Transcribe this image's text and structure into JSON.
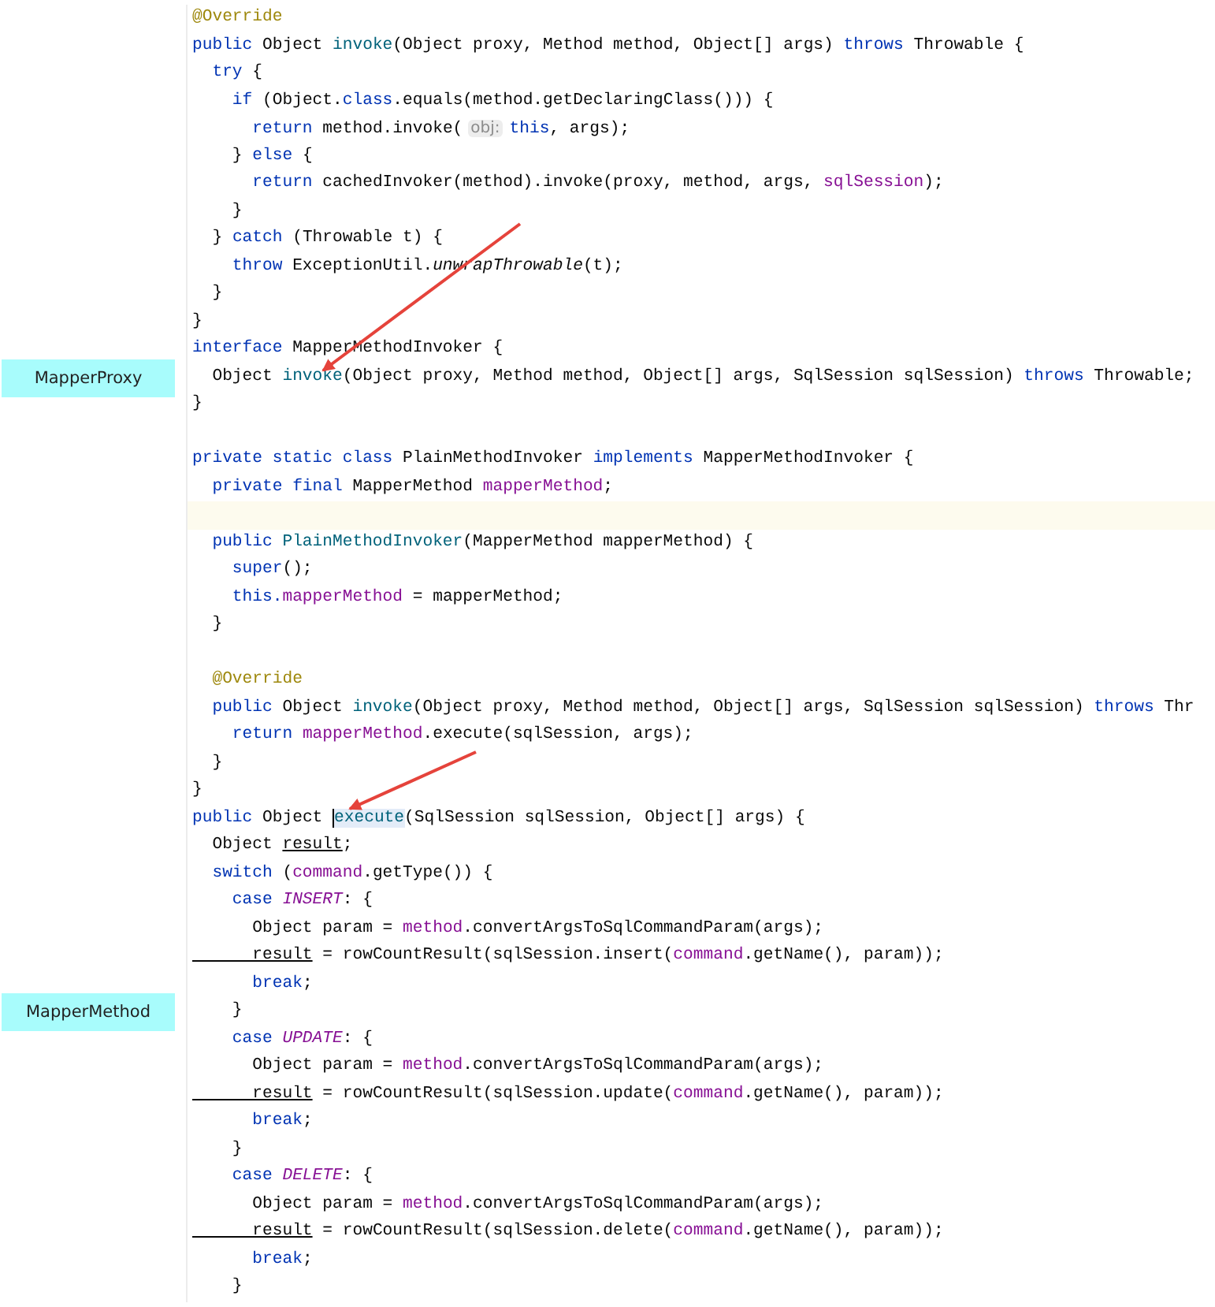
{
  "code_lines": [
    {
      "kind": "code",
      "tokens": [
        {
          "text": "@Override",
          "kind": "annotation"
        }
      ]
    },
    {
      "kind": "code",
      "tokens": [
        {
          "text": "public",
          "kind": "keyword"
        },
        {
          "text": " Object ",
          "kind": "plain"
        },
        {
          "text": "invoke",
          "kind": "declaration"
        },
        {
          "text": "(Object proxy, Method method, Object[] args) ",
          "kind": "plain"
        },
        {
          "text": "throws",
          "kind": "keyword"
        },
        {
          "text": " Throwable {",
          "kind": "plain"
        }
      ]
    },
    {
      "kind": "code",
      "tokens": [
        {
          "text": "  try",
          "kind": "keyword"
        },
        {
          "text": " {",
          "kind": "plain"
        }
      ]
    },
    {
      "kind": "code",
      "tokens": [
        {
          "text": "    if",
          "kind": "keyword"
        },
        {
          "text": " (Object.",
          "kind": "plain"
        },
        {
          "text": "class",
          "kind": "keyword"
        },
        {
          "text": ".equals(method.getDeclaringClass())) {",
          "kind": "plain"
        }
      ]
    },
    {
      "kind": "code",
      "tokens": [
        {
          "text": "      return",
          "kind": "keyword"
        },
        {
          "text": " method.invoke(",
          "kind": "plain"
        },
        {
          "text": "obj:",
          "kind": "hint"
        },
        {
          "text": "this",
          "kind": "keyword"
        },
        {
          "text": ", args);",
          "kind": "plain"
        }
      ]
    },
    {
      "kind": "code",
      "tokens": [
        {
          "text": "    } ",
          "kind": "plain"
        },
        {
          "text": "else",
          "kind": "keyword"
        },
        {
          "text": " {",
          "kind": "plain"
        }
      ]
    },
    {
      "kind": "code",
      "tokens": [
        {
          "text": "      return",
          "kind": "keyword"
        },
        {
          "text": " cachedInvoker(method).invoke(proxy, method, args, ",
          "kind": "plain"
        },
        {
          "text": "sqlSession",
          "kind": "field"
        },
        {
          "text": ");",
          "kind": "plain"
        }
      ]
    },
    {
      "kind": "code",
      "tokens": [
        {
          "text": "    }",
          "kind": "plain"
        }
      ]
    },
    {
      "kind": "code",
      "tokens": [
        {
          "text": "  } ",
          "kind": "plain"
        },
        {
          "text": "catch",
          "kind": "keyword"
        },
        {
          "text": " (Throwable t) {",
          "kind": "plain"
        }
      ]
    },
    {
      "kind": "code",
      "tokens": [
        {
          "text": "    throw",
          "kind": "keyword"
        },
        {
          "text": " ExceptionUtil.",
          "kind": "plain"
        },
        {
          "text": "unwrapThrowable",
          "kind": "static"
        },
        {
          "text": "(t);",
          "kind": "plain"
        }
      ]
    },
    {
      "kind": "code",
      "tokens": [
        {
          "text": "  }",
          "kind": "plain"
        }
      ]
    },
    {
      "kind": "code",
      "tokens": [
        {
          "text": "}",
          "kind": "plain"
        }
      ]
    },
    {
      "kind": "code",
      "tokens": [
        {
          "text": "interface",
          "kind": "keyword"
        },
        {
          "text": " MapperMethodInvoker {",
          "kind": "plain"
        }
      ]
    },
    {
      "kind": "code",
      "side_label": "MapperProxy",
      "tokens": [
        {
          "text": "  Object ",
          "kind": "plain"
        },
        {
          "text": "invoke",
          "kind": "declaration"
        },
        {
          "text": "(Object proxy, Method method, Object[] args, SqlSession sqlSession) ",
          "kind": "plain"
        },
        {
          "text": "throws",
          "kind": "keyword"
        },
        {
          "text": " Throwable;",
          "kind": "plain"
        }
      ]
    },
    {
      "kind": "code",
      "tokens": [
        {
          "text": "}",
          "kind": "plain"
        }
      ]
    },
    {
      "kind": "blank"
    },
    {
      "kind": "code",
      "tokens": [
        {
          "text": "private static class",
          "kind": "keyword"
        },
        {
          "text": " PlainMethodInvoker ",
          "kind": "plain"
        },
        {
          "text": "implements",
          "kind": "keyword"
        },
        {
          "text": " MapperMethodInvoker {",
          "kind": "plain"
        }
      ]
    },
    {
      "kind": "code",
      "tokens": [
        {
          "text": "  private final",
          "kind": "keyword"
        },
        {
          "text": " MapperMethod ",
          "kind": "plain"
        },
        {
          "text": "mapperMethod",
          "kind": "field"
        },
        {
          "text": ";",
          "kind": "plain"
        }
      ]
    },
    {
      "kind": "current"
    },
    {
      "kind": "code",
      "tokens": [
        {
          "text": "  public ",
          "kind": "keyword"
        },
        {
          "text": "PlainMethodInvoker",
          "kind": "declaration"
        },
        {
          "text": "(MapperMethod mapperMethod) {",
          "kind": "plain"
        }
      ]
    },
    {
      "kind": "code",
      "tokens": [
        {
          "text": "    super",
          "kind": "keyword"
        },
        {
          "text": "();",
          "kind": "plain"
        }
      ]
    },
    {
      "kind": "code",
      "tokens": [
        {
          "text": "    this.",
          "kind": "keyword"
        },
        {
          "text": "mapperMethod",
          "kind": "field"
        },
        {
          "text": " = mapperMethod;",
          "kind": "plain"
        }
      ]
    },
    {
      "kind": "code",
      "tokens": [
        {
          "text": "  }",
          "kind": "plain"
        }
      ]
    },
    {
      "kind": "blank"
    },
    {
      "kind": "code",
      "tokens": [
        {
          "text": "  @Override",
          "kind": "annotation"
        }
      ]
    },
    {
      "kind": "code",
      "tokens": [
        {
          "text": "  public",
          "kind": "keyword"
        },
        {
          "text": " Object ",
          "kind": "plain"
        },
        {
          "text": "invoke",
          "kind": "declaration"
        },
        {
          "text": "(Object proxy, Method method, Object[] args, SqlSession sqlSession) ",
          "kind": "plain"
        },
        {
          "text": "throws",
          "kind": "keyword"
        },
        {
          "text": " Thr",
          "kind": "plain"
        }
      ]
    },
    {
      "kind": "code",
      "tokens": [
        {
          "text": "    return ",
          "kind": "keyword"
        },
        {
          "text": "mapperMethod",
          "kind": "field"
        },
        {
          "text": ".execute(sqlSession, args);",
          "kind": "plain"
        }
      ]
    },
    {
      "kind": "code",
      "tokens": [
        {
          "text": "  }",
          "kind": "plain"
        }
      ]
    },
    {
      "kind": "code",
      "tokens": [
        {
          "text": "}",
          "kind": "plain"
        }
      ]
    },
    {
      "kind": "code",
      "tokens": [
        {
          "text": "public",
          "kind": "keyword"
        },
        {
          "text": " Object ",
          "kind": "plain"
        },
        {
          "text": "execute",
          "kind": "focus"
        },
        {
          "text": "(SqlSession sqlSession, Object[] args) {",
          "kind": "plain"
        }
      ]
    },
    {
      "kind": "code",
      "tokens": [
        {
          "text": "  Object ",
          "kind": "plain"
        },
        {
          "text": "result",
          "kind": "reassigned"
        },
        {
          "text": ";",
          "kind": "plain"
        }
      ]
    },
    {
      "kind": "code",
      "tokens": [
        {
          "text": "  switch",
          "kind": "keyword"
        },
        {
          "text": " (",
          "kind": "plain"
        },
        {
          "text": "command",
          "kind": "field"
        },
        {
          "text": ".getType()) {",
          "kind": "plain"
        }
      ]
    },
    {
      "kind": "code",
      "tokens": [
        {
          "text": "    case ",
          "kind": "keyword"
        },
        {
          "text": "INSERT",
          "kind": "constant"
        },
        {
          "text": ": {",
          "kind": "plain"
        }
      ]
    },
    {
      "kind": "code",
      "tokens": [
        {
          "text": "      Object param = ",
          "kind": "plain"
        },
        {
          "text": "method",
          "kind": "field"
        },
        {
          "text": ".convertArgsToSqlCommandParam(args);",
          "kind": "plain"
        }
      ]
    },
    {
      "kind": "code",
      "tokens": [
        {
          "text": "      result",
          "kind": "reassigned"
        },
        {
          "text": " = rowCountResult(sqlSession.insert(",
          "kind": "plain"
        },
        {
          "text": "command",
          "kind": "field"
        },
        {
          "text": ".getName(), param));",
          "kind": "plain"
        }
      ]
    },
    {
      "kind": "code",
      "tokens": [
        {
          "text": "      break",
          "kind": "keyword"
        },
        {
          "text": ";",
          "kind": "plain"
        }
      ]
    },
    {
      "kind": "code",
      "side_label": "MapperMethod",
      "tokens": [
        {
          "text": "    }",
          "kind": "plain"
        }
      ]
    },
    {
      "kind": "code",
      "tokens": [
        {
          "text": "    case ",
          "kind": "keyword"
        },
        {
          "text": "UPDATE",
          "kind": "constant"
        },
        {
          "text": ": {",
          "kind": "plain"
        }
      ]
    },
    {
      "kind": "code",
      "tokens": [
        {
          "text": "      Object param = ",
          "kind": "plain"
        },
        {
          "text": "method",
          "kind": "field"
        },
        {
          "text": ".convertArgsToSqlCommandParam(args);",
          "kind": "plain"
        }
      ]
    },
    {
      "kind": "code",
      "tokens": [
        {
          "text": "      result",
          "kind": "reassigned"
        },
        {
          "text": " = rowCountResult(sqlSession.update(",
          "kind": "plain"
        },
        {
          "text": "command",
          "kind": "field"
        },
        {
          "text": ".getName(), param));",
          "kind": "plain"
        }
      ]
    },
    {
      "kind": "code",
      "tokens": [
        {
          "text": "      break",
          "kind": "keyword"
        },
        {
          "text": ";",
          "kind": "plain"
        }
      ]
    },
    {
      "kind": "code",
      "tokens": [
        {
          "text": "    }",
          "kind": "plain"
        }
      ]
    },
    {
      "kind": "code",
      "tokens": [
        {
          "text": "    case ",
          "kind": "keyword"
        },
        {
          "text": "DELETE",
          "kind": "constant"
        },
        {
          "text": ": {",
          "kind": "plain"
        }
      ]
    },
    {
      "kind": "code",
      "tokens": [
        {
          "text": "      Object param = ",
          "kind": "plain"
        },
        {
          "text": "method",
          "kind": "field"
        },
        {
          "text": ".convertArgsToSqlCommandParam(args);",
          "kind": "plain"
        }
      ]
    },
    {
      "kind": "code",
      "tokens": [
        {
          "text": "      result",
          "kind": "reassigned"
        },
        {
          "text": " = rowCountResult(sqlSession.delete(",
          "kind": "plain"
        },
        {
          "text": "command",
          "kind": "field"
        },
        {
          "text": ".getName(), param));",
          "kind": "plain"
        }
      ]
    },
    {
      "kind": "code",
      "tokens": [
        {
          "text": "      break",
          "kind": "keyword"
        },
        {
          "text": ";",
          "kind": "plain"
        }
      ]
    },
    {
      "kind": "code",
      "tokens": [
        {
          "text": "    }",
          "kind": "plain"
        }
      ]
    }
  ]
}
